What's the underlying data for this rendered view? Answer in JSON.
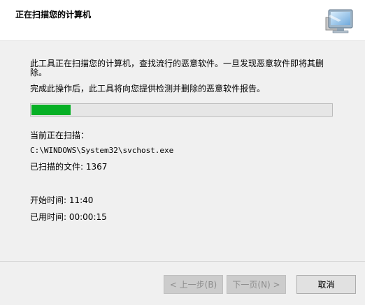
{
  "header": {
    "title": "正在扫描您的计算机",
    "icon": "computer-scan-icon"
  },
  "main": {
    "description": "此工具正在扫描您的计算机，查找流行的恶意软件。一旦发现恶意软件即将其删除。",
    "description2": "完成此操作后，此工具将向您提供检测并删除的恶意软件报告。",
    "progress": 0.13,
    "current_label": "当前正在扫描：",
    "current_file": "C:\\WINDOWS\\System32\\svchost.exe",
    "scanned_files": "已扫描的文件: 1367",
    "start_time": "开始时间: 11:40",
    "elapsed_time": "已用时间: 00:00:15"
  },
  "buttons": {
    "back": "< 上一步(B)",
    "next": "下一页(N) >",
    "cancel": "取消"
  },
  "colors": {
    "progress_fill": "#06b025",
    "background": "#f0f0f0"
  }
}
